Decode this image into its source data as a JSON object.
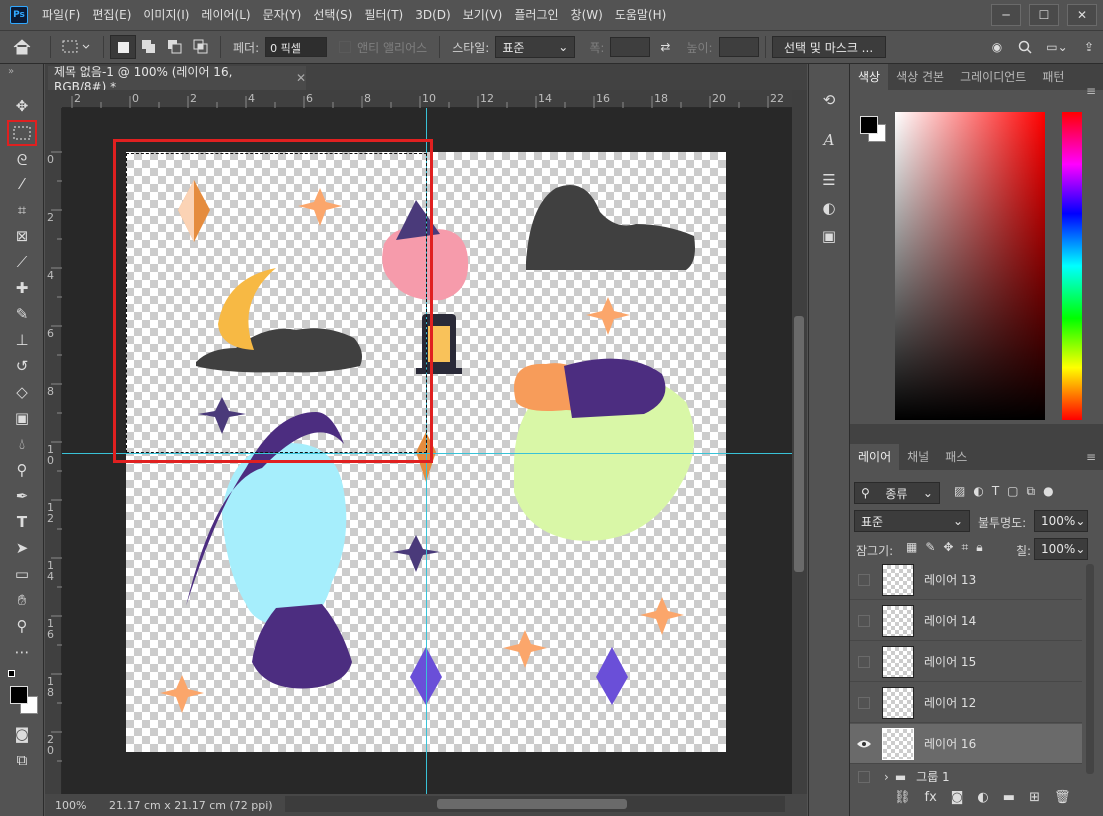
{
  "app": {
    "logo_text": "Ps"
  },
  "menu": [
    "파일(F)",
    "편집(E)",
    "이미지(I)",
    "레이어(L)",
    "문자(Y)",
    "선택(S)",
    "필터(T)",
    "3D(D)",
    "보기(V)",
    "플러그인",
    "창(W)",
    "도움말(H)"
  ],
  "options": {
    "feather_label": "페더:",
    "feather_value": "0 픽셀",
    "antialias_label": "앤티 앨리어스",
    "style_label": "스타일:",
    "style_value": "표준",
    "width_label": "폭:",
    "height_label": "높이:",
    "select_mask_button": "선택 및 마스크 ..."
  },
  "document": {
    "tab_title": "제목 없음-1 @ 100% (레이어 16, RGB/8#) *"
  },
  "ruler_h": [
    "2",
    "0",
    "2",
    "4",
    "6",
    "8",
    "10",
    "12",
    "14",
    "16",
    "18",
    "20",
    "22"
  ],
  "ruler_v": [
    "0",
    "2",
    "4",
    "6",
    "8",
    "1 0",
    "1 2",
    "1 4",
    "1 6",
    "1 8",
    "2 0"
  ],
  "status": {
    "zoom": "100%",
    "doc_size": "21.17 cm x 21.17 cm (72 ppi)"
  },
  "color_panel": {
    "tabs": [
      "색상",
      "색상 견본",
      "그레이디언트",
      "패턴"
    ]
  },
  "layers_panel": {
    "tabs": [
      "레이어",
      "채널",
      "패스"
    ],
    "filter_label": "종류",
    "blend_mode": "표준",
    "opacity_label": "불투명도:",
    "opacity_value": "100%",
    "lock_label": "잠그기:",
    "fill_label": "칠:",
    "fill_value": "100%",
    "layers": [
      {
        "name": "레이어 13",
        "visible": false,
        "selected": false
      },
      {
        "name": "레이어 14",
        "visible": false,
        "selected": false
      },
      {
        "name": "레이어 15",
        "visible": false,
        "selected": false
      },
      {
        "name": "레이어 12",
        "visible": false,
        "selected": false
      },
      {
        "name": "레이어 16",
        "visible": true,
        "selected": true
      },
      {
        "name": "그룹 1",
        "visible": false,
        "selected": false
      }
    ]
  },
  "colors": {
    "accent": "#31a8ff",
    "highlight_red": "#e02020",
    "guide": "#39c2d7"
  }
}
